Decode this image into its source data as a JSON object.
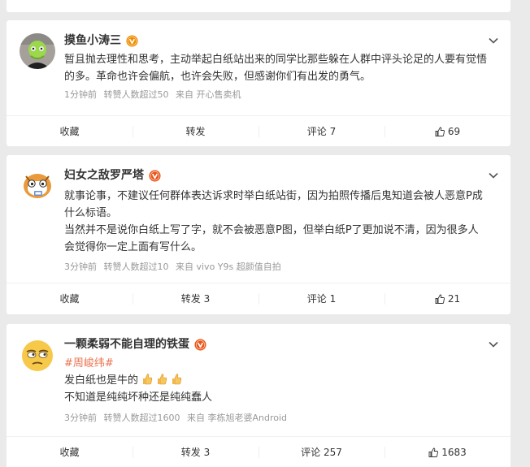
{
  "posts": [
    {
      "username": "摸鱼小涛三",
      "content": [
        "暂且抛去理性和思考，主动举起白纸站出来的同学比那些躲在人群中评头论足的人要有觉悟的多。革命也许会偏航，也许会失败，但感谢你们有出发的勇气。"
      ],
      "time": "1分钟前",
      "reposts": "转赞人数超过50",
      "source": "来自 开心售卖机",
      "actions": {
        "collect": "收藏",
        "repost": "转发",
        "comment": "评论 7",
        "like": "69"
      }
    },
    {
      "username": "妇女之敌罗严塔",
      "content": [
        "就事论事，不建议任何群体表达诉求时举白纸站街，因为拍照传播后鬼知道会被人恶意P成什么标语。",
        "当然并不是说你白纸上写了字，就不会被恶意P图，但举白纸P了更加说不清，因为很多人会觉得你一定上面有写什么。"
      ],
      "time": "3分钟前",
      "reposts": "转赞人数超过10",
      "source": "来自 vivo Y9s 超颜值自拍",
      "actions": {
        "collect": "收藏",
        "repost": "转发 3",
        "comment": "评论 1",
        "like": "21"
      }
    },
    {
      "username": "一颗柔弱不能自理的铁蛋",
      "hashtag": "#周峻纬#",
      "line1": "发白纸也是牛的",
      "line2": "不知道是纯纯坏种还是纯纯蠢人",
      "time": "3分钟前",
      "reposts": "转赞人数超过1600",
      "source": "来自 李栋旭老婆Android",
      "actions": {
        "collect": "收藏",
        "repost": "转发 3",
        "comment": "评论 257",
        "like": "1683"
      }
    }
  ],
  "icons": {
    "verified": "orange-v-badge",
    "menu": "chevron-down",
    "like": "thumbs-up",
    "emoji": "thumbs-up-emoji"
  },
  "colors": {
    "accent": "#eb7350",
    "badge": "#f08c00",
    "meta": "#999999"
  }
}
